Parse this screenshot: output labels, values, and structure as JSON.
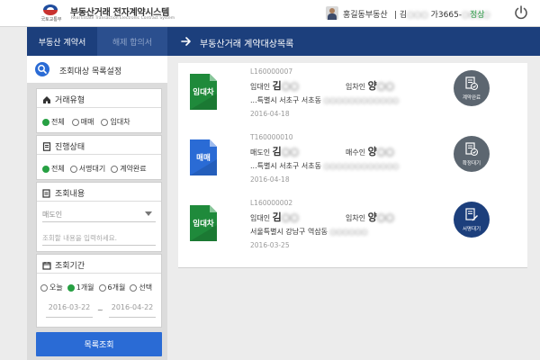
{
  "header": {
    "logo_subtext": "국토교통부",
    "app_title": "부동산거래 전자계약시스템",
    "app_subtitle": "Real Estate Transaction Electronic Contract System",
    "user_name": "홍길동부동산",
    "user_phone_prefix": "| 김",
    "user_phone_blurred": "○○○",
    "user_phone_mid": " 가3665-",
    "user_phone_tail": "○○○○",
    "status_text": "정상",
    "power_icon": "power-icon",
    "colors": {
      "status": "#2b9b45",
      "brand_blue": "#1c3f7c"
    }
  },
  "tabs": [
    {
      "label": "부동산 계약서",
      "active": true
    },
    {
      "label": "해제 합의서",
      "active": false
    }
  ],
  "main": {
    "title": "부동산거래 계약대상목록"
  },
  "sidebar": {
    "search_title": "조회대상 목록설정",
    "trade_type": {
      "title": "거래유형",
      "options": [
        "전체",
        "매매",
        "임대차"
      ],
      "selected": "전체"
    },
    "progress": {
      "title": "진행상태",
      "options": [
        "전체",
        "서명대기",
        "계약완료"
      ],
      "selected": "전체"
    },
    "query": {
      "title": "조회내용",
      "select_value": "매도인",
      "input_placeholder": "조회할 내용을 입력하세요."
    },
    "period": {
      "title": "조회기간",
      "options": [
        "오늘",
        "1개월",
        "6개월",
        "선택"
      ],
      "selected": "1개월",
      "from": "2016-03-22",
      "tilde": "~",
      "to": "2016-04-22"
    },
    "search_button": "목록조회"
  },
  "contracts": [
    {
      "code": "L160000007",
      "type_label": "임대차",
      "doc_color": "#1f8a3b",
      "left_role": "임대인",
      "left_name": "김",
      "left_blur": "○○",
      "right_role": "임차인",
      "right_name": "양",
      "right_blur": "○○",
      "address": "...특별시 서초구 서초동",
      "address_blur": "○○○○○○○○○○○○",
      "date": "2016-04-18",
      "status": "계약완료",
      "status_style": "gray"
    },
    {
      "code": "T160000010",
      "type_label": "매매",
      "doc_color": "#2a6bd5",
      "left_role": "매도인",
      "left_name": "김",
      "left_blur": "○○",
      "right_role": "매수인",
      "right_name": "양",
      "right_blur": "○○",
      "address": "...특별시 서초구 서초동",
      "address_blur": "○○○○○○○○○○○○",
      "date": "2016-04-18",
      "status": "확정대기",
      "status_style": "gray"
    },
    {
      "code": "L160000002",
      "type_label": "임대차",
      "doc_color": "#1f8a3b",
      "left_role": "임대인",
      "left_name": "김",
      "left_blur": "○○",
      "right_role": "임차인",
      "right_name": "양",
      "right_blur": "○○",
      "address": "서울특별시 강남구 역삼동",
      "address_blur": "○○○○○○",
      "date": "2016-03-25",
      "status": "서명대기",
      "status_style": "navy"
    }
  ]
}
